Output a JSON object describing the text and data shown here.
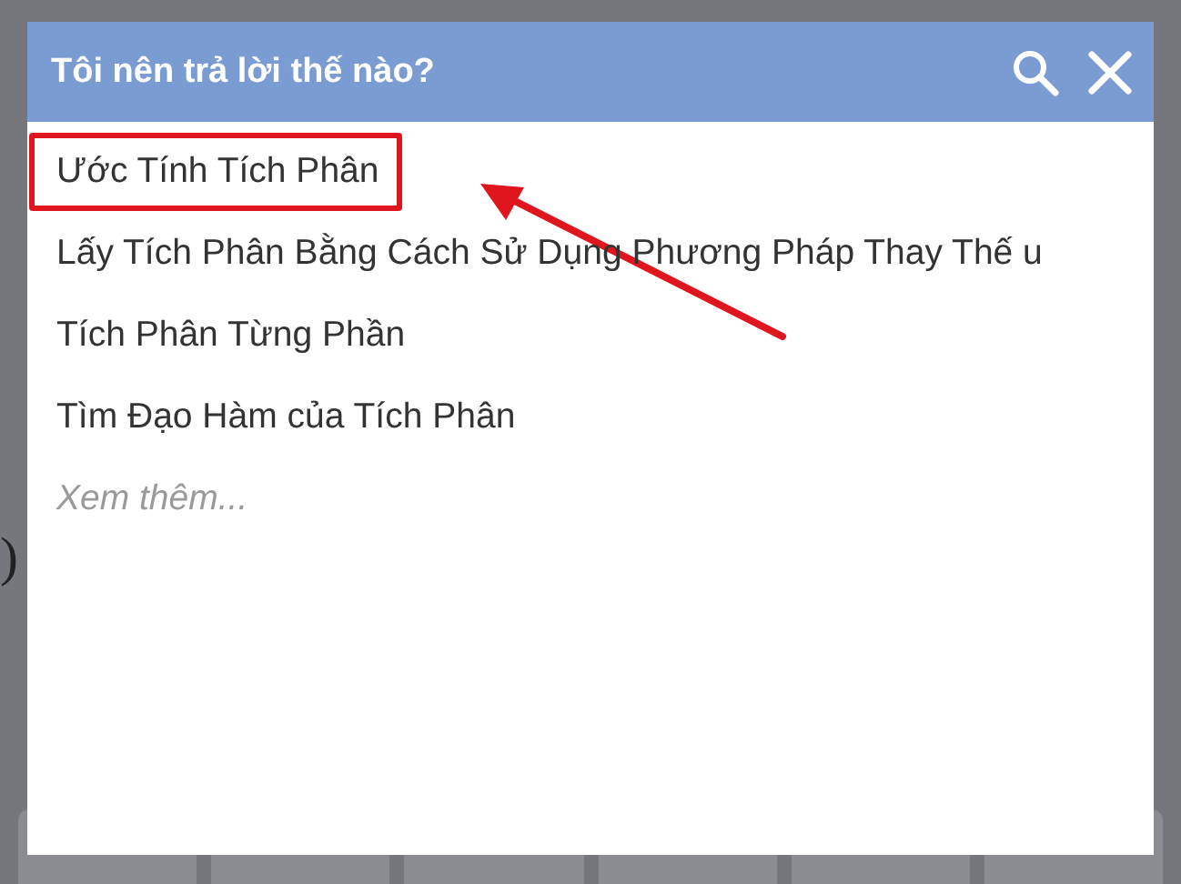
{
  "backdrop": {
    "fragment": ")"
  },
  "dialog": {
    "title": "Tôi nên trả lời thế nào?",
    "items": [
      {
        "label": "Ước Tính Tích Phân",
        "kind": "option",
        "highlighted": true
      },
      {
        "label": "Lấy Tích Phân Bằng Cách Sử Dụng Phương Pháp Thay Thế u",
        "kind": "option",
        "highlighted": false
      },
      {
        "label": "Tích Phân Từng Phần",
        "kind": "option",
        "highlighted": false
      },
      {
        "label": "Tìm Đạo Hàm của Tích Phân",
        "kind": "option",
        "highlighted": false
      },
      {
        "label": "Xem thêm...",
        "kind": "more",
        "highlighted": false
      }
    ]
  }
}
